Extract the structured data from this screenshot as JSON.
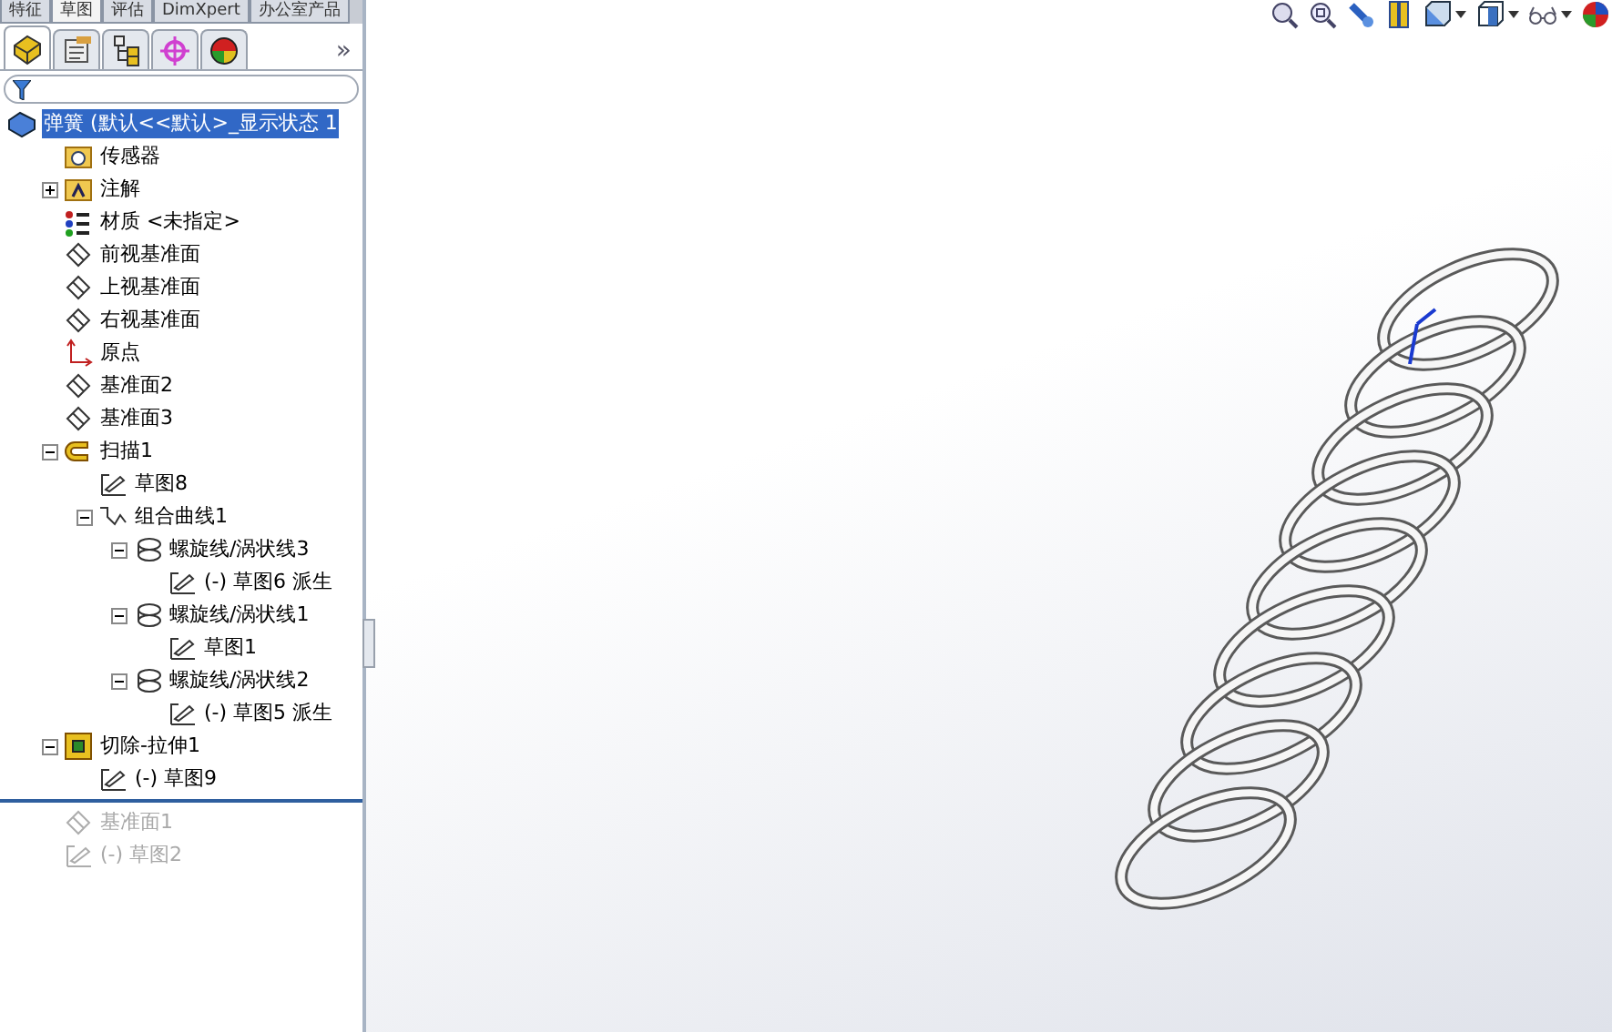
{
  "top_tabs": [
    {
      "label": "特征",
      "selected": false
    },
    {
      "label": "草图",
      "selected": true
    },
    {
      "label": "评估",
      "selected": false
    },
    {
      "label": "DimXpert",
      "selected": false
    },
    {
      "label": "办公室产品",
      "selected": false
    }
  ],
  "manager_tabs": [
    {
      "kind": "feature",
      "selected": true
    },
    {
      "kind": "property",
      "selected": false
    },
    {
      "kind": "config",
      "selected": false
    },
    {
      "kind": "dimxpert",
      "selected": false
    },
    {
      "kind": "display",
      "selected": false
    }
  ],
  "more_label": "»",
  "tree": {
    "label": "弹簧  (默认<<默认>_显示状态 1",
    "kind": "part",
    "selected": true,
    "children": [
      {
        "label": "传感器",
        "kind": "sensor",
        "rolled_back": false
      },
      {
        "label": "注解",
        "kind": "annotation",
        "expanded": false,
        "rolled_back": false
      },
      {
        "label": "材质 <未指定>",
        "kind": "material",
        "rolled_back": false
      },
      {
        "label": "前视基准面",
        "kind": "plane",
        "rolled_back": false
      },
      {
        "label": "上视基准面",
        "kind": "plane",
        "rolled_back": false
      },
      {
        "label": "右视基准面",
        "kind": "plane",
        "rolled_back": false
      },
      {
        "label": "原点",
        "kind": "origin",
        "rolled_back": false
      },
      {
        "label": "基准面2",
        "kind": "plane",
        "rolled_back": false
      },
      {
        "label": "基准面3",
        "kind": "plane",
        "rolled_back": false
      },
      {
        "label": "扫描1",
        "kind": "sweep",
        "expanded": true,
        "rolled_back": false,
        "children": [
          {
            "label": "草图8",
            "kind": "sketch"
          },
          {
            "label": "组合曲线1",
            "kind": "curve",
            "expanded": true,
            "children": [
              {
                "label": "螺旋线/涡状线3",
                "kind": "helix",
                "expanded": true,
                "children": [
                  {
                    "label": "(-) 草图6 派生",
                    "kind": "sketch"
                  }
                ]
              },
              {
                "label": "螺旋线/涡状线1",
                "kind": "helix",
                "expanded": true,
                "children": [
                  {
                    "label": "草图1",
                    "kind": "sketch"
                  }
                ]
              },
              {
                "label": "螺旋线/涡状线2",
                "kind": "helix",
                "expanded": true,
                "children": [
                  {
                    "label": "(-) 草图5 派生",
                    "kind": "sketch"
                  }
                ]
              }
            ]
          }
        ]
      },
      {
        "label": "切除-拉伸1",
        "kind": "cut",
        "expanded": true,
        "rolled_back": false,
        "children": [
          {
            "label": "(-) 草图9",
            "kind": "sketch"
          }
        ]
      },
      {
        "label": "基准面1",
        "kind": "plane",
        "rolled_back": true
      },
      {
        "label": "(-) 草图2",
        "kind": "sketch",
        "rolled_back": true
      }
    ]
  },
  "view_toolbar": [
    {
      "kind": "zoom-fit"
    },
    {
      "kind": "zoom-area"
    },
    {
      "kind": "previous"
    },
    {
      "kind": "section"
    },
    {
      "kind": "orientation",
      "dropdown": true
    },
    {
      "kind": "display",
      "dropdown": true
    },
    {
      "kind": "hide-show",
      "dropdown": true
    },
    {
      "kind": "appearance"
    }
  ]
}
